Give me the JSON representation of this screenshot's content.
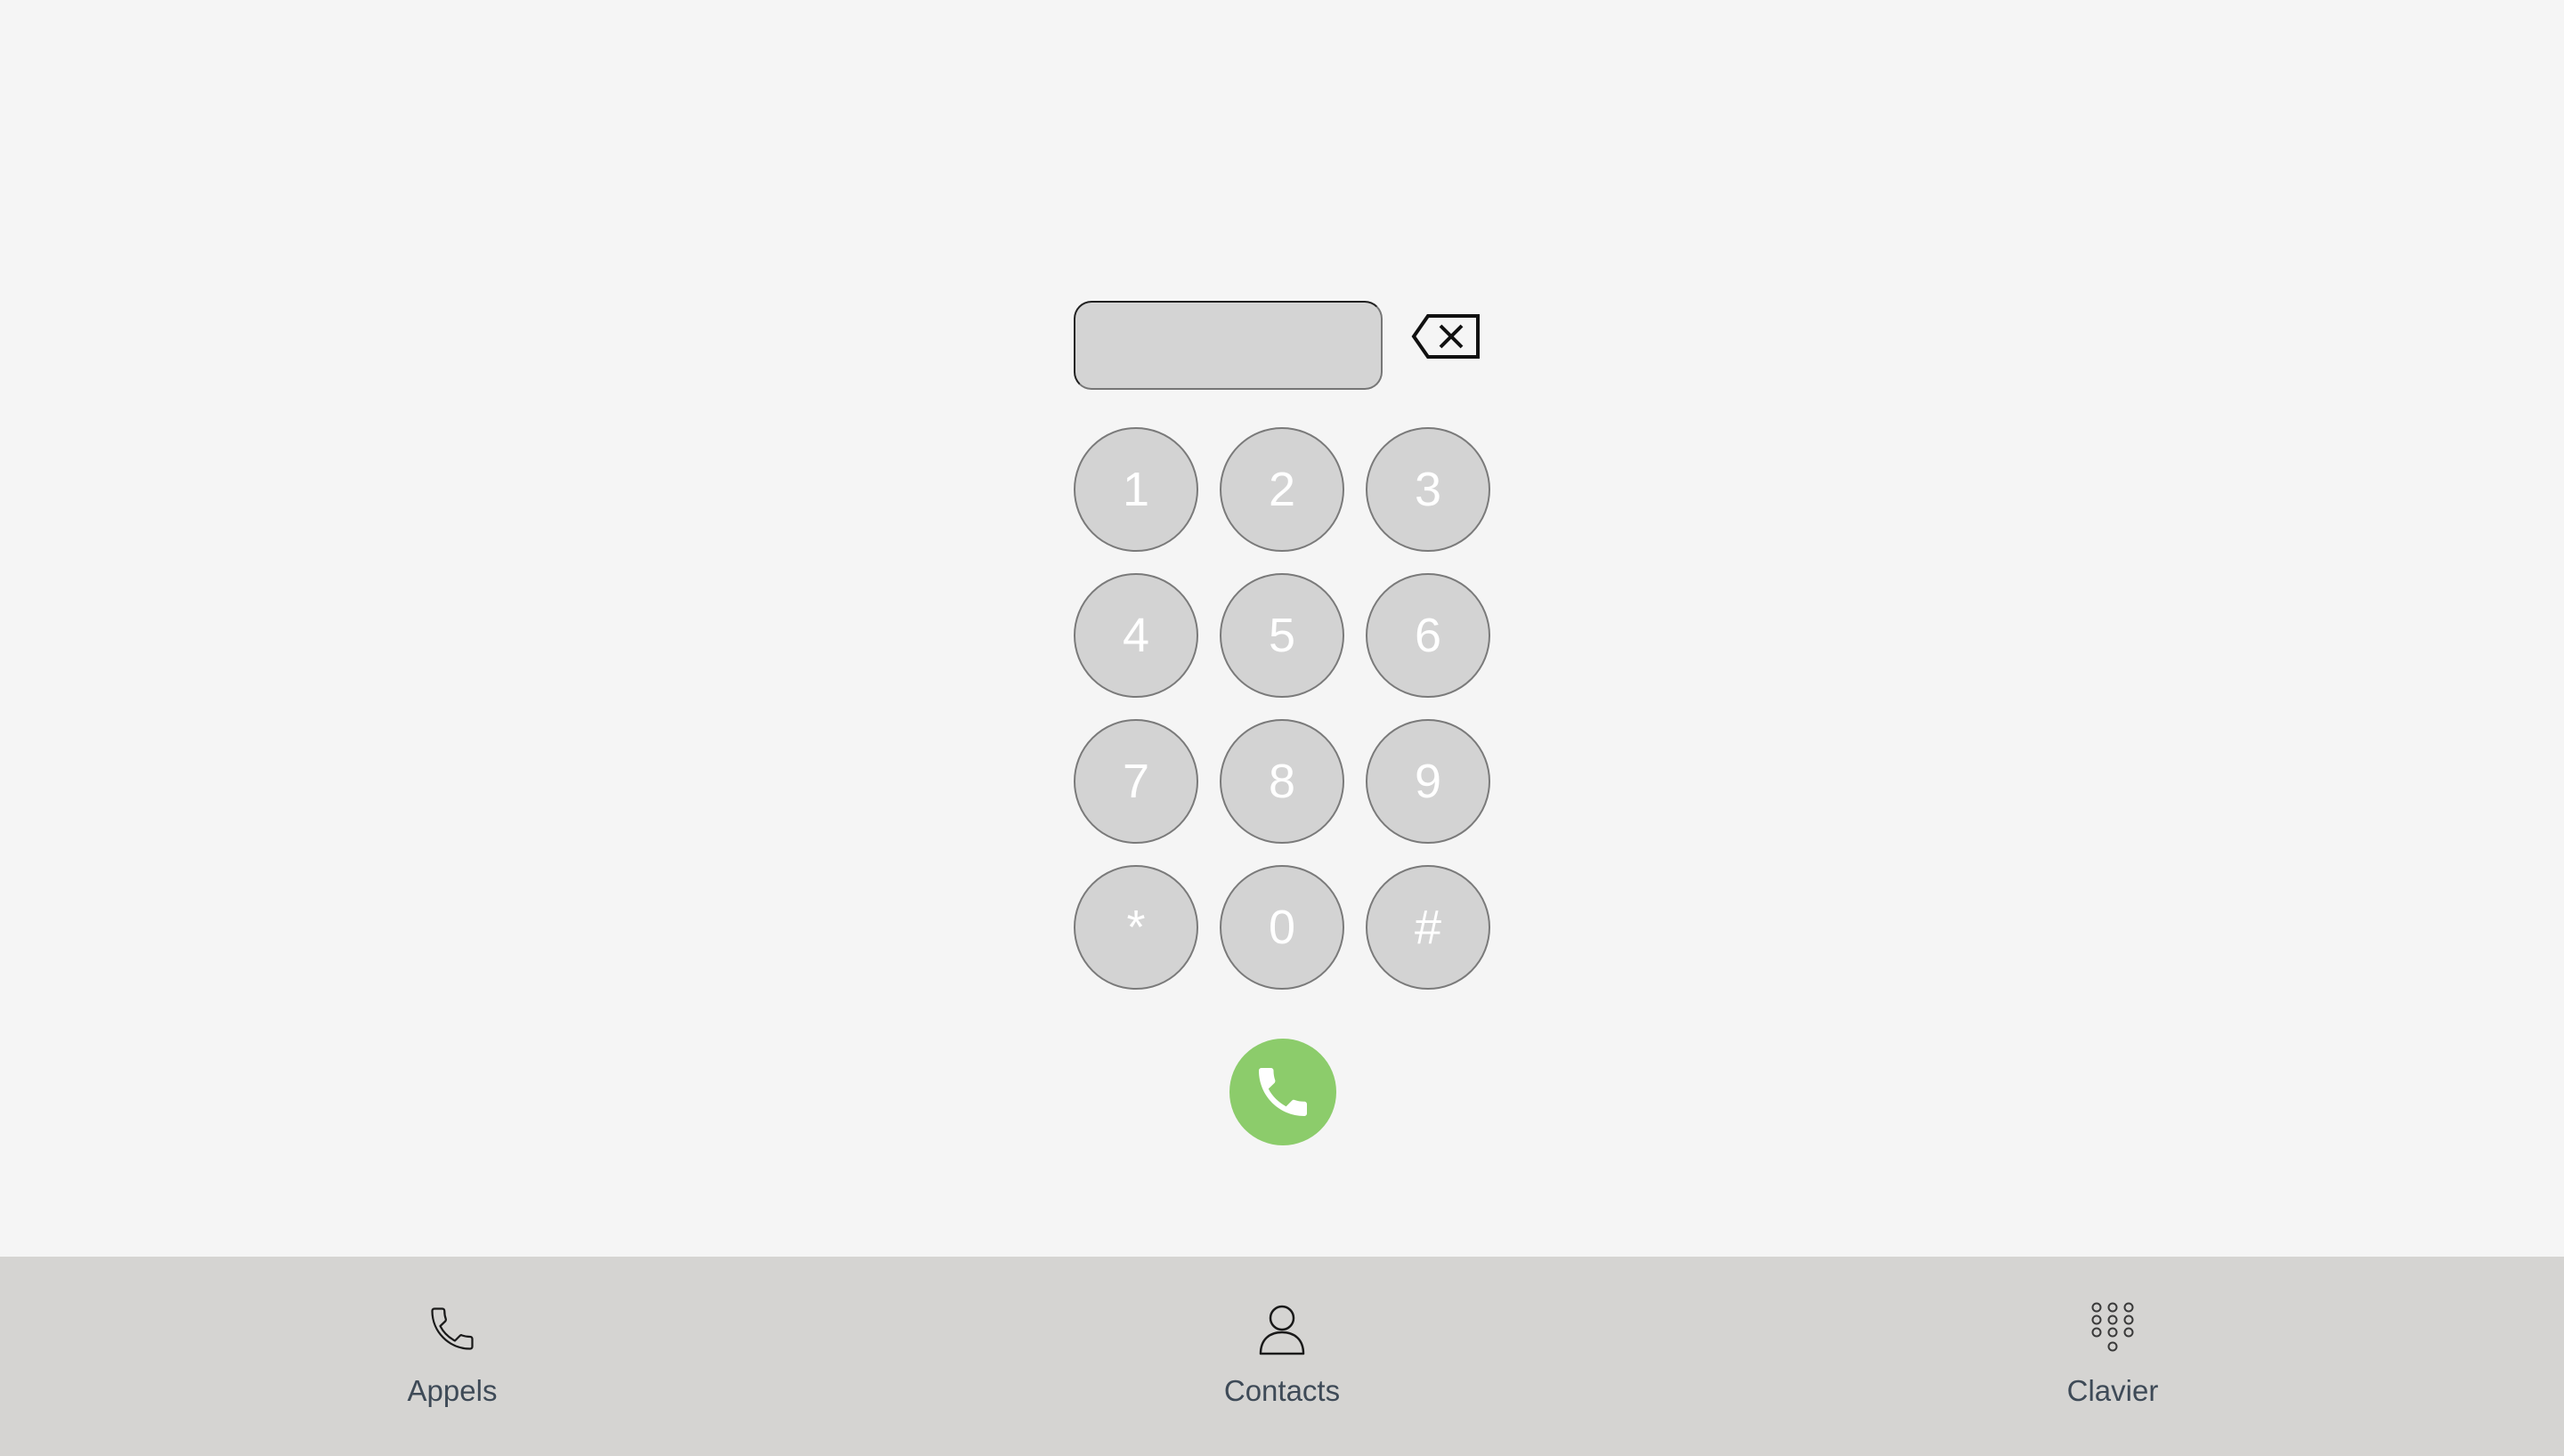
{
  "dialer": {
    "number_value": "",
    "number_placeholder": "",
    "keys": [
      "1",
      "2",
      "3",
      "4",
      "5",
      "6",
      "7",
      "8",
      "9",
      "*",
      "0",
      "#"
    ],
    "backspace_icon": "backspace-icon",
    "call_icon": "phone-icon"
  },
  "tabs": [
    {
      "label": "Appels",
      "icon": "phone-icon"
    },
    {
      "label": "Contacts",
      "icon": "person-icon"
    },
    {
      "label": "Clavier",
      "icon": "keypad-icon"
    }
  ],
  "colors": {
    "background": "#f5f5f5",
    "key_fill": "#d3d3d3",
    "key_border": "#7a7a7a",
    "call_green": "#8ccc6b",
    "tabbar": "#d5d4d2",
    "tab_label": "#3e4a57"
  }
}
